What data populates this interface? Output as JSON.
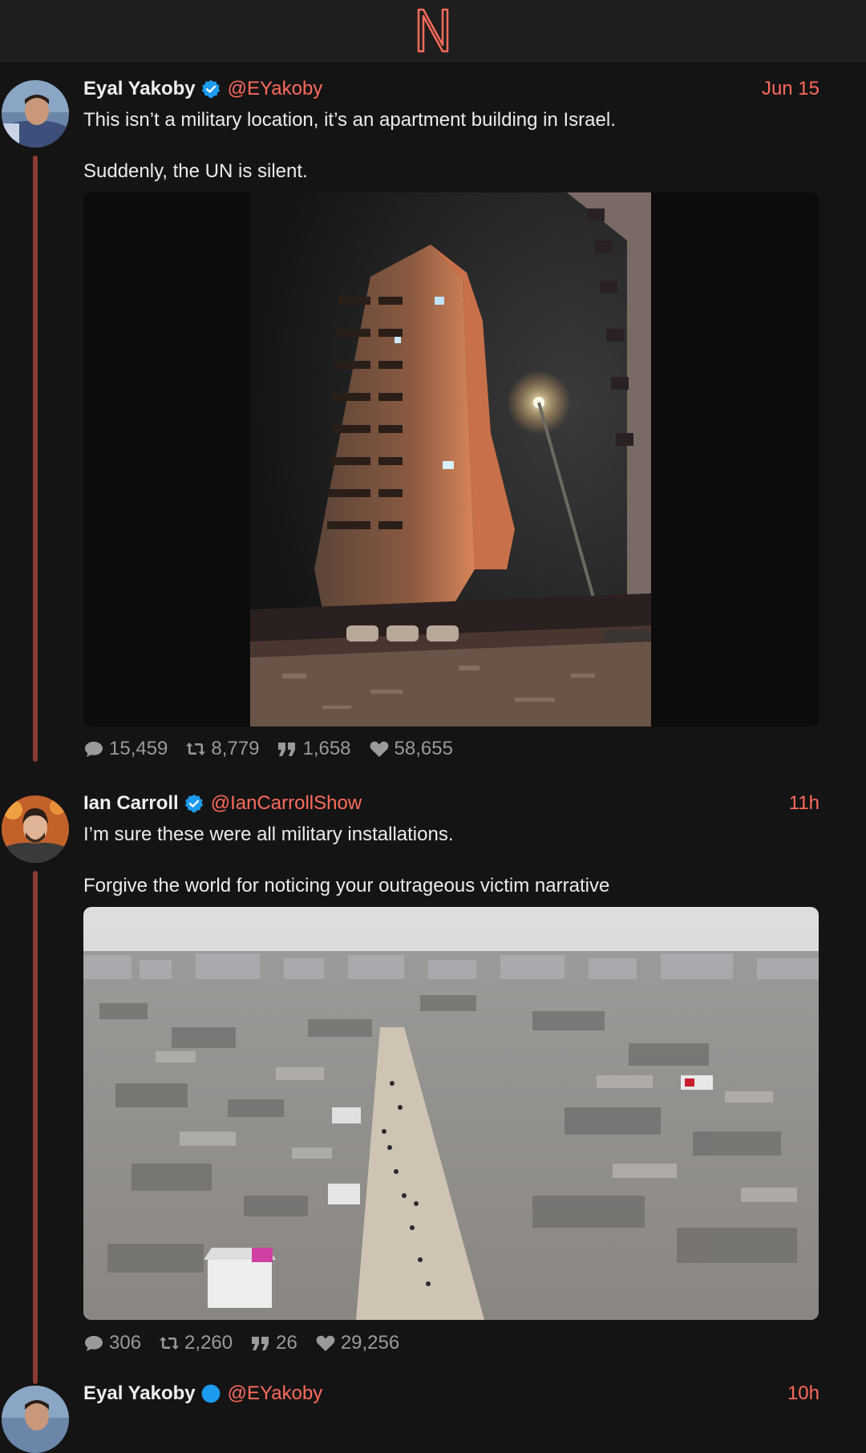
{
  "app": {
    "logo_letter": "N",
    "accent": "#ff6b5b",
    "thread_color": "#8b3a33"
  },
  "posts": [
    {
      "author": "Eyal Yakoby",
      "handle": "@EYakoby",
      "time": "Jun 15",
      "verified": true,
      "text": [
        "This isn’t a military location, it’s an apartment building in Israel.",
        "Suddenly, the UN is silent."
      ],
      "media": "image: damaged apartment tower at night, lit by a street lamp",
      "stats": {
        "replies": "15,459",
        "reposts": "8,779",
        "quotes": "1,658",
        "likes": "58,655"
      }
    },
    {
      "author": "Ian Carroll",
      "handle": "@IanCarrollShow",
      "time": "11h",
      "verified": true,
      "text": [
        "I’m sure these were all military installations.",
        "Forgive the world for noticing your outrageous victim narrative"
      ],
      "media": "image: aerial view of a city reduced to rubble with people walking along a road",
      "stats": {
        "replies": "306",
        "reposts": "2,260",
        "quotes": "26",
        "likes": "29,256"
      }
    },
    {
      "author": "Eyal Yakoby",
      "handle": "@EYakoby",
      "time": "10h"
    }
  ],
  "icons": {
    "reply": "reply-icon",
    "repost": "repost-icon",
    "quote": "quote-icon",
    "like": "heart-icon",
    "verified": "verified-badge-icon"
  }
}
